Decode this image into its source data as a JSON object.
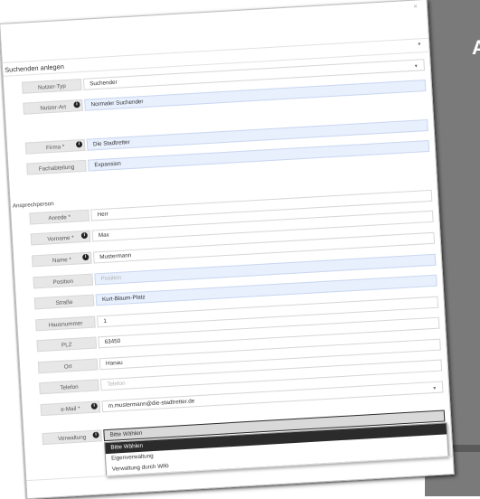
{
  "background": {
    "letter": "A"
  },
  "modal": {
    "close_icon": "×",
    "title": "Suchenden anlegen",
    "section_ansprechperson": "Ansprechperson",
    "fields": [
      {
        "label": "Nutzer-Typ",
        "value": "Suchender",
        "info": false,
        "highlight": false,
        "placeholder": false,
        "select": true
      },
      {
        "label": "Nutzer-Art",
        "value": "Normaler Suchender",
        "info": true,
        "highlight": true,
        "placeholder": false,
        "select": false
      },
      {
        "label": "Firma *",
        "value": "Die Stadtretter",
        "info": true,
        "highlight": true,
        "placeholder": false,
        "select": false
      },
      {
        "label": "Fachabteilung",
        "value": "Expansion",
        "info": false,
        "highlight": true,
        "placeholder": false,
        "select": false
      },
      {
        "label": "Anrede *",
        "value": "Herr",
        "info": false,
        "highlight": false,
        "placeholder": false,
        "select": false
      },
      {
        "label": "Vorname *",
        "value": "Max",
        "info": true,
        "highlight": false,
        "placeholder": false,
        "select": false
      },
      {
        "label": "Name *",
        "value": "Mustermann",
        "info": true,
        "highlight": false,
        "placeholder": false,
        "select": false
      },
      {
        "label": "Position",
        "value": "Position",
        "info": false,
        "highlight": true,
        "placeholder": true,
        "select": false
      },
      {
        "label": "Straße",
        "value": "Kurt-Blaum-Platz",
        "info": false,
        "highlight": true,
        "placeholder": false,
        "select": false
      },
      {
        "label": "Hausnummer",
        "value": "1",
        "info": false,
        "highlight": false,
        "placeholder": false,
        "select": false
      },
      {
        "label": "PLZ",
        "value": "63450",
        "info": false,
        "highlight": false,
        "placeholder": false,
        "select": false
      },
      {
        "label": "Ort",
        "value": "Hanau",
        "info": false,
        "highlight": false,
        "placeholder": false,
        "select": false
      },
      {
        "label": "Telefon",
        "value": "Telefon",
        "info": false,
        "highlight": false,
        "placeholder": true,
        "select": false
      },
      {
        "label": "e-Mail *",
        "value": "m.mustermann@die-stadtretter.de",
        "info": true,
        "highlight": false,
        "placeholder": false,
        "select": true
      },
      {
        "label": "Verwaltung",
        "value": "Bitte Wählen",
        "info": true,
        "highlight": false,
        "placeholder": false,
        "select": false
      }
    ],
    "verwaltung_options": [
      {
        "label": "Bitte Wählen",
        "active": true
      },
      {
        "label": "Eigenverwaltung",
        "active": false
      },
      {
        "label": "Verwaltung durch Wifö",
        "active": false
      }
    ]
  },
  "colors": {
    "highlight_bg": "#e8f0fe",
    "label_bg": "#e7e7e7",
    "dropdown_active": "#2b2b2b",
    "backdrop": "#7a7a7a"
  }
}
